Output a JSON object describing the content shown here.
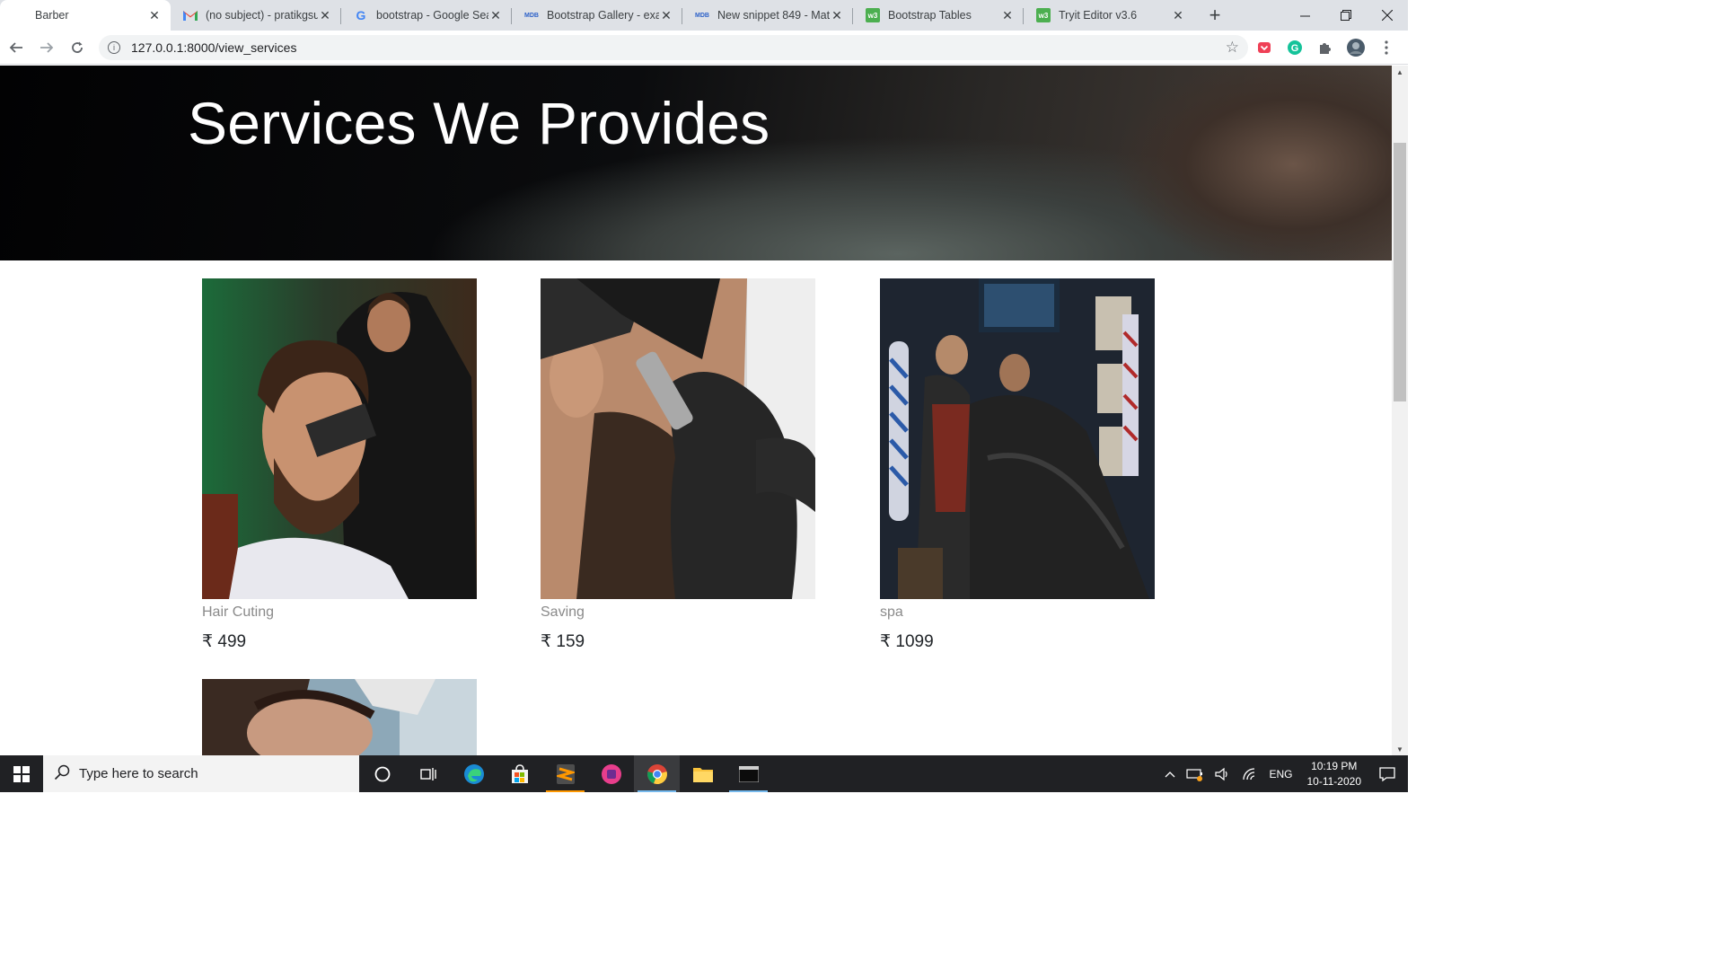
{
  "browser": {
    "tabs": [
      {
        "title": "Barber",
        "favicon": "blank",
        "active": true
      },
      {
        "title": "(no subject) - pratikgsu",
        "favicon": "gmail-icon"
      },
      {
        "title": "bootstrap - Google Sea",
        "favicon": "google-icon"
      },
      {
        "title": "Bootstrap Gallery - exa",
        "favicon": "mdb-icon"
      },
      {
        "title": "New snippet 849 - Mat",
        "favicon": "mdb-icon"
      },
      {
        "title": "Bootstrap Tables",
        "favicon": "w3-icon"
      },
      {
        "title": "Tryit Editor v3.6",
        "favicon": "w3-icon"
      }
    ],
    "url": "127.0.0.1:8000/view_services"
  },
  "page": {
    "heading": "Services We Provides",
    "services": [
      {
        "name": "Hair Cuting",
        "currency": "₹",
        "price": "499"
      },
      {
        "name": "Saving",
        "currency": "₹",
        "price": "159"
      },
      {
        "name": "spa",
        "currency": "₹",
        "price": "1099"
      }
    ]
  },
  "taskbar": {
    "search_placeholder": "Type here to search",
    "language": "ENG",
    "time": "10:19 PM",
    "date": "10-11-2020"
  },
  "colors": {
    "tabbar_bg": "#dee1e6",
    "taskbar_bg": "#202124",
    "price_text": "#212529",
    "name_text": "#8a8a8a"
  }
}
